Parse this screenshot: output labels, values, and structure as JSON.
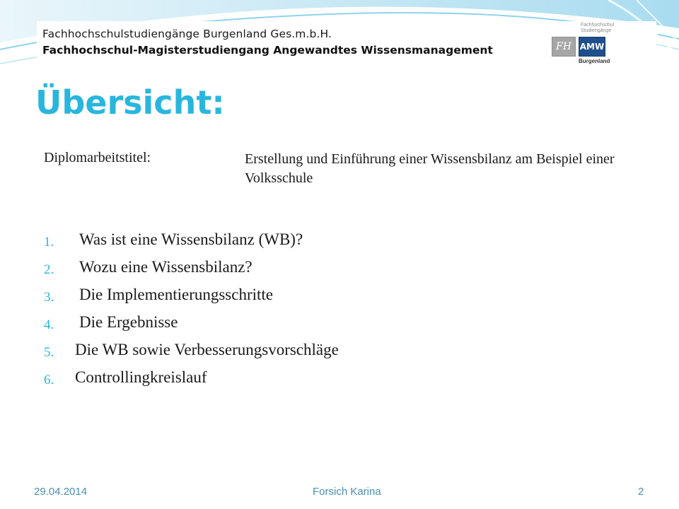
{
  "banner": {
    "line1": "Fachhochschulstudiengänge Burgenland Ges.m.b.H.",
    "line2": "Fachhochschul-Magisterstudiengang Angewandtes Wissensmanagement",
    "logo_caption_1": "Fachhochschul",
    "logo_caption_2": "Studiengänge",
    "logo_fh": "FH",
    "logo_amw": "AMW",
    "logo_region": "Burgenland"
  },
  "slide": {
    "title": "Übersicht:",
    "thesis_label": "Diplomarbeitstitel:",
    "thesis_value": "Erstellung und Einführung einer Wissensbilanz am Beispiel einer Volksschule"
  },
  "agenda": [
    {
      "num": "1.",
      "text": "Was ist eine Wissensbilanz (WB)?"
    },
    {
      "num": "2.",
      "text": "Wozu eine Wissensbilanz?"
    },
    {
      "num": "3.",
      "text": "Die Implementierungsschritte"
    },
    {
      "num": "4.",
      "text": "Die Ergebnisse"
    },
    {
      "num": "5.",
      "text": "Die WB sowie Verbesserungsvorschläge"
    },
    {
      "num": "6.",
      "text": "Controllingkreislauf"
    }
  ],
  "footer": {
    "date": "29.04.2014",
    "author": "Forsich Karina",
    "page": "2"
  },
  "colors": {
    "accent": "#29b6dd",
    "footer_text": "#4a8fb0",
    "logo_blue": "#1f4f8c"
  }
}
